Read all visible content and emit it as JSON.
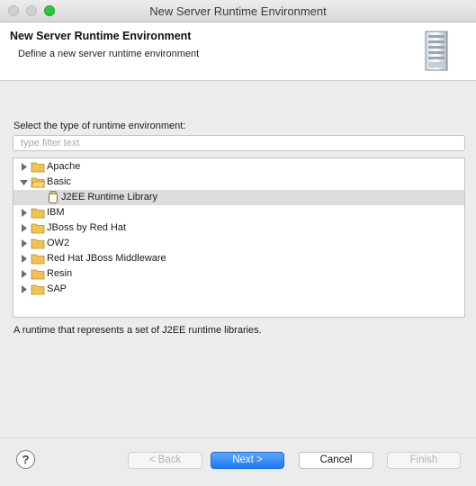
{
  "window": {
    "title": "New Server Runtime Environment"
  },
  "banner": {
    "title": "New Server Runtime Environment",
    "description": "Define a new server runtime environment"
  },
  "main": {
    "label": "Select the type of runtime environment:",
    "filter_placeholder": "type filter text",
    "tree": [
      {
        "label": "Apache",
        "icon": "folder-icon",
        "expanded": false
      },
      {
        "label": "Basic",
        "icon": "folder-open-icon",
        "expanded": true
      },
      {
        "label": "J2EE Runtime Library",
        "icon": "library-icon",
        "child": true,
        "selected": true
      },
      {
        "label": "IBM",
        "icon": "folder-icon",
        "expanded": false
      },
      {
        "label": "JBoss by Red Hat",
        "icon": "folder-icon",
        "expanded": false
      },
      {
        "label": "OW2",
        "icon": "folder-icon",
        "expanded": false
      },
      {
        "label": "Red Hat JBoss Middleware",
        "icon": "folder-icon",
        "expanded": false
      },
      {
        "label": "Resin",
        "icon": "folder-icon",
        "expanded": false
      },
      {
        "label": "SAP",
        "icon": "folder-icon",
        "expanded": false
      }
    ],
    "description": "A runtime that represents a set of J2EE runtime libraries."
  },
  "footer": {
    "help_label": "?",
    "back_label": "< Back",
    "next_label": "Next >",
    "cancel_label": "Cancel",
    "finish_label": "Finish"
  },
  "colors": {
    "accent": "#1f7af3",
    "folder": "#f0c454",
    "selection": "#dcdcdc"
  }
}
